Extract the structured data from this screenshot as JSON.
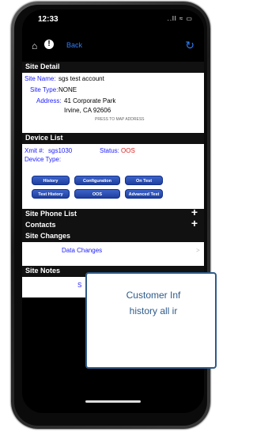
{
  "status_bar": {
    "time": "12:33",
    "icons": "..ll ≈ ▭"
  },
  "navbar": {
    "home_icon": "⌂",
    "alert_icon": "!",
    "back_label": "Back",
    "refresh_icon": "↻"
  },
  "site_detail": {
    "header": "Site Detail",
    "site_name_label": "Site Name:",
    "site_name_value": "sgs test account",
    "site_type_label": "Site Type:",
    "site_type_value": "NONE",
    "address_label": "Address:",
    "address_line1": "41 Corporate Park",
    "address_line2": "Irvine, CA 92606",
    "press_to_map": "PRESS TO MAP ADDRESS"
  },
  "device_list": {
    "header": "Device List",
    "xmit_label": "Xmit #:",
    "xmit_value": "sgs1030",
    "status_label": "Status:",
    "status_value": "OOS",
    "device_type_label": "Device Type:",
    "buttons": [
      "History",
      "Configuration",
      "On Test",
      "Test History",
      "OOS",
      "Advanced Test"
    ]
  },
  "site_phone_list": {
    "header": "Site Phone List",
    "plus": "+"
  },
  "contacts": {
    "header": "Contacts",
    "plus": "+"
  },
  "site_changes": {
    "header": "Site Changes",
    "data_changes": "Data Changes",
    "chevron": ">"
  },
  "site_notes": {
    "header": "Site Notes",
    "partial": "S"
  },
  "popup": {
    "line1": "Customer Inf",
    "line2": "history all ir"
  }
}
